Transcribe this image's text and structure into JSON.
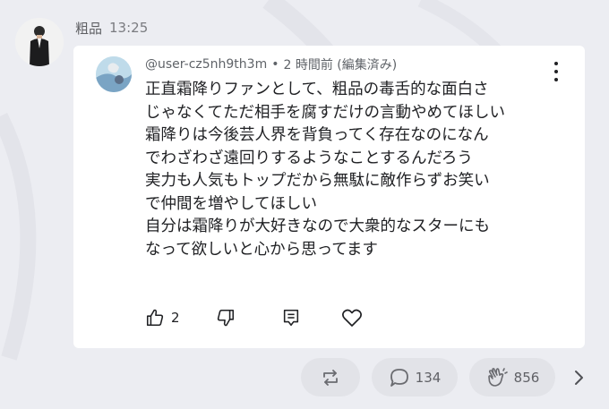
{
  "post": {
    "author": "粗品",
    "time": "13:25"
  },
  "comment": {
    "handle": "@user-cz5nh9th3m",
    "separator": "•",
    "age": "2 時間前 (編集済み)",
    "lines": [
      "正直霜降りファンとして、粗品の毒舌的な面白さ",
      "じゃなくてただ相手を腐すだけの言動やめてほしい",
      "霜降りは今後芸人界を背負ってく存在なのになん",
      "でわざわざ遠回りするようなことするんだろう",
      "実力も人気もトップだから無駄に敵作らずお笑い",
      "で仲間を増やしてほしい",
      "自分は霜降りが大好きなので大衆的なスターにも",
      "なって欲しいと心から思ってます"
    ],
    "like_count": "2"
  },
  "footer": {
    "comment_count": "134",
    "clap_count": "856"
  },
  "icons": {
    "more": "more-vert-icon",
    "like": "thumbs-up-icon",
    "dislike": "thumbs-down-icon",
    "reply": "reply-icon",
    "heart": "heart-icon",
    "repost": "repost-icon",
    "comment": "comment-bubble-icon",
    "clap": "clap-icon",
    "next": "chevron-right-icon"
  },
  "colors": {
    "background": "#ecedf2",
    "card": "#ffffff",
    "footer_button": "#e2e3e8"
  }
}
